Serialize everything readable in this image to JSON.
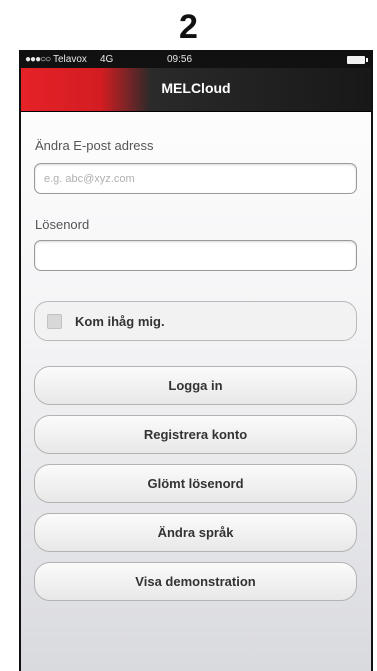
{
  "step_number": "2",
  "status_bar": {
    "signal": "●●●○○",
    "carrier": "Telavox",
    "network": "4G",
    "time": "09:56"
  },
  "nav": {
    "title": "MELCloud"
  },
  "form": {
    "email_label": "Ändra E-post adress",
    "email_placeholder": "e.g. abc@xyz.com",
    "email_value": "",
    "password_label": "Lösenord",
    "password_value": "",
    "remember_label": "Kom ihåg mig."
  },
  "buttons": {
    "login": "Logga in",
    "register": "Registrera konto",
    "forgot": "Glömt lösenord",
    "language": "Ändra språk",
    "demo": "Visa demonstration"
  },
  "colors": {
    "accent": "#e52227",
    "nav_dark": "#181818"
  }
}
